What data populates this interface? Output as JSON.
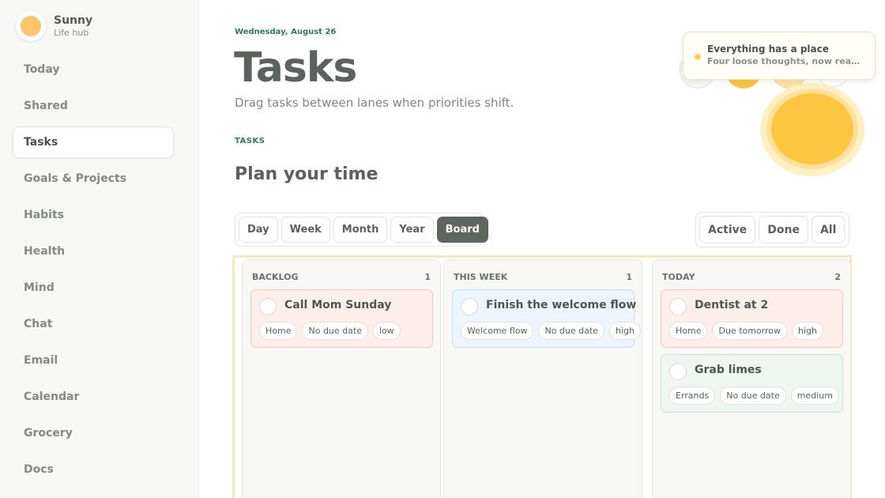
{
  "brand": {
    "name": "Sunny",
    "subtitle": "Life hub"
  },
  "nav": [
    {
      "label": "Today",
      "active": false
    },
    {
      "label": "Shared",
      "active": false
    },
    {
      "label": "Tasks",
      "active": true
    },
    {
      "label": "Goals & Projects",
      "active": false
    },
    {
      "label": "Habits",
      "active": false
    },
    {
      "label": "Health",
      "active": false
    },
    {
      "label": "Mind",
      "active": false
    },
    {
      "label": "Chat",
      "active": false
    },
    {
      "label": "Email",
      "active": false
    },
    {
      "label": "Calendar",
      "active": false
    },
    {
      "label": "Grocery",
      "active": false
    },
    {
      "label": "Docs",
      "active": false
    }
  ],
  "header": {
    "date": "Wednesday, August 26",
    "title": "Tasks",
    "subtitle": "Drag tasks between lanes when priorities shift."
  },
  "section": {
    "label": "TASKS",
    "title": "Plan your time"
  },
  "toast": {
    "title": "Everything has a place",
    "body": "Four loose thoughts, now ready to be dropped into the right lanes."
  },
  "view_tabs": [
    {
      "label": "Day",
      "active": false
    },
    {
      "label": "Week",
      "active": false
    },
    {
      "label": "Month",
      "active": false
    },
    {
      "label": "Year",
      "active": false
    },
    {
      "label": "Board",
      "active": true
    }
  ],
  "status_tabs": [
    {
      "label": "Active"
    },
    {
      "label": "Done"
    },
    {
      "label": "All"
    }
  ],
  "lanes": [
    {
      "title": "BACKLOG",
      "count": "1",
      "cards": [
        {
          "title": "Call Mom Sunday",
          "color": "red",
          "tags": [
            "Home",
            "No due date",
            "low"
          ]
        }
      ]
    },
    {
      "title": "THIS WEEK",
      "count": "1",
      "cards": [
        {
          "title": "Finish the welcome flow",
          "color": "blue",
          "tags": [
            "Welcome flow",
            "No due date",
            "high"
          ]
        }
      ]
    },
    {
      "title": "TODAY",
      "count": "2",
      "cards": [
        {
          "title": "Dentist at 2",
          "color": "red",
          "tags": [
            "Home",
            "Due tomorrow",
            "high"
          ]
        },
        {
          "title": "Grab limes",
          "color": "green",
          "tags": [
            "Errands",
            "No due date",
            "medium"
          ]
        }
      ]
    }
  ],
  "colors": {
    "accent_green": "#2e7d4f",
    "sun_yellow": "#fcc640",
    "active_dark": "#5f6661"
  }
}
